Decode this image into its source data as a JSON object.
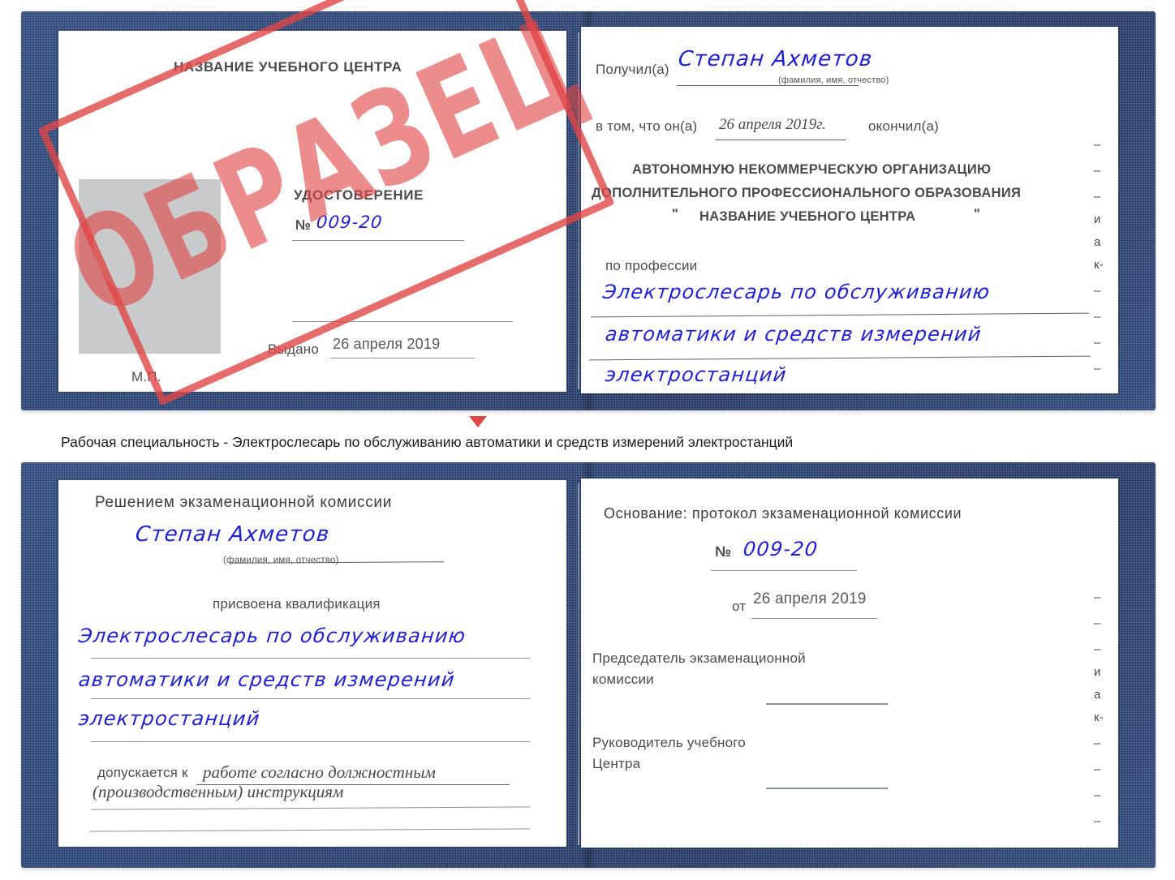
{
  "colors": {
    "cover_blue": "#24407a",
    "handwriting_blue": "#1f1fd6",
    "stamp_red": "#e04646",
    "photo_placeholder_gray": "#c9cacb",
    "rule_gray": "#8d9299",
    "body_text_gray": "#4a4a4a"
  },
  "stamp": {
    "label": "ОБРАЗЕЦ"
  },
  "certificate_top": {
    "left_page": {
      "heading": "НАЗВАНИЕ УЧЕБНОГО ЦЕНТРА",
      "doc_type": "УДОСТОВЕРЕНИЕ",
      "number_label": "№",
      "number_value": "009-20",
      "issued_label": "Выдано",
      "issued_date": "26 апреля 2019",
      "seal_label": "М.П.",
      "photo_placeholder": ""
    },
    "right_page": {
      "received_label": "Получил(а)",
      "received_name": "Степан Ахметов",
      "name_hint": "(фамилия, имя, отчество)",
      "in_that_label": "в том, что он(а)",
      "completion_date": "26 апреля 2019г.",
      "completed_label": "окончил(а)",
      "org_line1": "АВТОНОМНУЮ НЕКОММЕРЧЕСКУЮ ОРГАНИЗАЦИЮ",
      "org_line2": "ДОПОЛНИТЕЛЬНОГО ПРОФЕССИОНАЛЬНОГО ОБРАЗОВАНИЯ",
      "org_quote_open": "\"",
      "org_line3": "НАЗВАНИЕ УЧЕБНОГО ЦЕНТРА",
      "org_quote_close": "\"",
      "profession_label": "по профессии",
      "profession_line1": "Электрослесарь по обслуживанию",
      "profession_line2": "автоматики и средств измерений",
      "profession_line3": "электростанций",
      "edge_fragments": [
        "–",
        "–",
        "–",
        "и",
        "а",
        "к-",
        "–",
        "–",
        "–",
        "–"
      ]
    }
  },
  "caption": {
    "text": "Рабочая специальность - Электрослесарь по обслуживанию автоматики и средств измерений электростанций"
  },
  "certificate_bottom": {
    "left_page": {
      "heading": "Решением экзаменационной комиссии",
      "name": "Степан Ахметов",
      "name_hint": "(фамилия, имя, отчество)",
      "qualification_label": "присвоена квалификация",
      "qualification_line1": "Электрослесарь по обслуживанию",
      "qualification_line2": "автоматики и средств измерений",
      "qualification_line3": "электростанций",
      "admitted_label": "допускается к",
      "admitted_line1": "работе согласно должностным",
      "admitted_line2": "(производственным) инструкциям"
    },
    "right_page": {
      "basis_label": "Основание: протокол экзаменационной комиссии",
      "number_label": "№",
      "number_value": "009-20",
      "date_label": "от",
      "date_value": "26 апреля 2019",
      "chairman_line1": "Председатель экзаменационной",
      "chairman_line2": "комиссии",
      "head_line1": "Руководитель учебного",
      "head_line2": "Центра",
      "edge_fragments": [
        "–",
        "–",
        "–",
        "и",
        "а",
        "к-",
        "–",
        "–",
        "–",
        "–"
      ]
    }
  }
}
